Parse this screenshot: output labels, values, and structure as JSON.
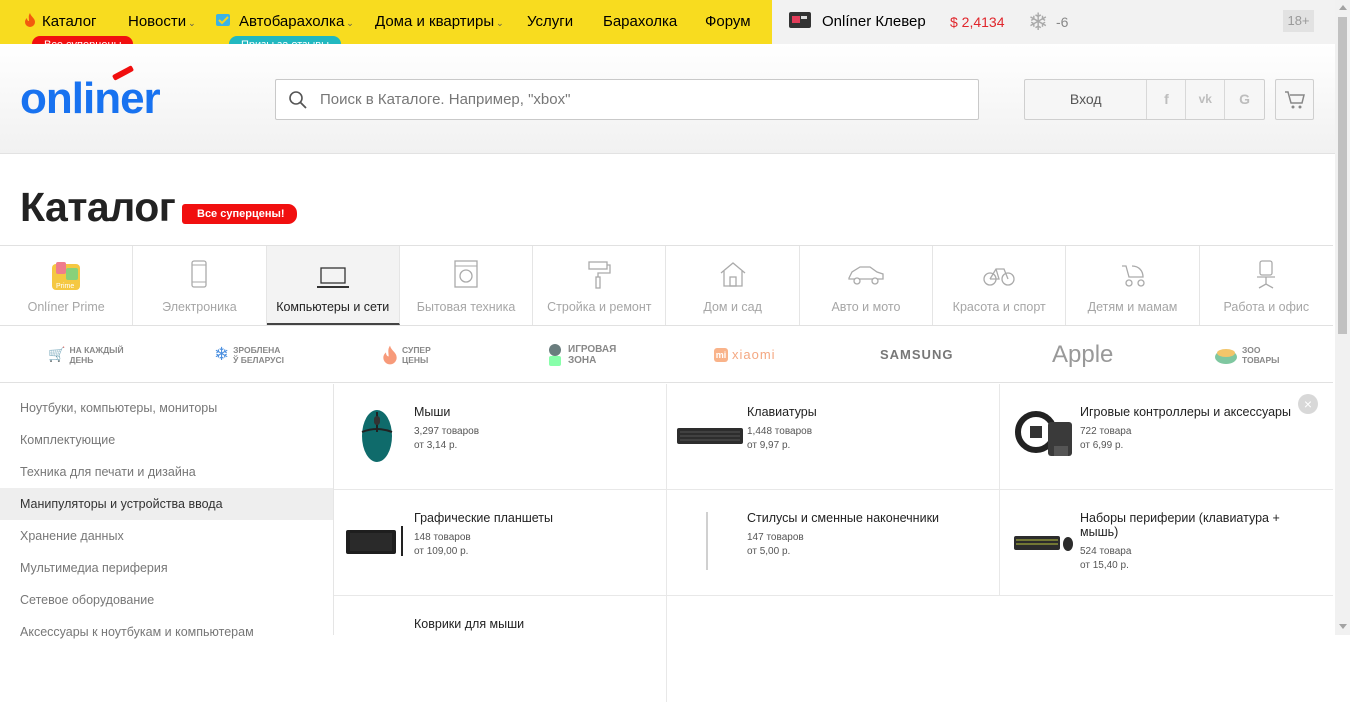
{
  "topnav": {
    "items": [
      {
        "label": "Каталог"
      },
      {
        "label": "Новости"
      },
      {
        "label": "Автобарахолка"
      },
      {
        "label": "Дома и квартиры"
      },
      {
        "label": "Услуги"
      },
      {
        "label": "Барахолка"
      },
      {
        "label": "Форум"
      }
    ],
    "badge_catalog": "Все суперцены",
    "badge_auto": "Призы за отзывы",
    "clever": "Onlíner Клевер",
    "currency": "$ 2,4134",
    "weather": "-6",
    "age": "18+"
  },
  "header": {
    "logo": "onliner",
    "search_placeholder": "Поиск в Каталоге. Например, \"xbox\"",
    "login": "Вход",
    "social": [
      "f",
      "vk",
      "G"
    ]
  },
  "page": {
    "title": "Каталог",
    "badge": "Все суперцены!"
  },
  "categories": [
    {
      "label": "Onlíner Prime",
      "icon": "prime-icon"
    },
    {
      "label": "Электроника",
      "icon": "phone-icon"
    },
    {
      "label": "Компьютеры и сети",
      "icon": "laptop-icon",
      "active": true
    },
    {
      "label": "Бытовая техника",
      "icon": "washer-icon"
    },
    {
      "label": "Стройка и ремонт",
      "icon": "paint-roller-icon"
    },
    {
      "label": "Дом и сад",
      "icon": "house-icon"
    },
    {
      "label": "Авто и мото",
      "icon": "car-icon"
    },
    {
      "label": "Красота и спорт",
      "icon": "bicycle-icon"
    },
    {
      "label": "Детям и мамам",
      "icon": "stroller-icon"
    },
    {
      "label": "Работа и офис",
      "icon": "office-chair-icon"
    }
  ],
  "promos": [
    {
      "text": "На каждый\nдень"
    },
    {
      "text": "Зроблена\nў Беларусі"
    },
    {
      "text": "Супер\nцены"
    },
    {
      "text": "Игровая\nзона"
    },
    {
      "text": "xiaomi"
    },
    {
      "text": "SAMSUNG"
    },
    {
      "text": "Apple"
    },
    {
      "text": "Зоо\nтовары"
    }
  ],
  "sidebar": [
    {
      "label": "Ноутбуки, компьютеры, мониторы"
    },
    {
      "label": "Комплектующие"
    },
    {
      "label": "Техника для печати и дизайна"
    },
    {
      "label": "Манипуляторы и устройства ввода",
      "active": true
    },
    {
      "label": "Хранение данных"
    },
    {
      "label": "Мультимедиа периферия"
    },
    {
      "label": "Сетевое оборудование"
    },
    {
      "label": "Аксессуары к ноутбукам и компьютерам"
    }
  ],
  "products": [
    {
      "name": "Мыши",
      "count": "3,297 товаров",
      "price": "от 3,14 р."
    },
    {
      "name": "Клавиатуры",
      "count": "1,448 товаров",
      "price": "от 9,97 р."
    },
    {
      "name": "Игровые контроллеры и аксессуары",
      "count": "722 товара",
      "price": "от 6,99 р."
    },
    {
      "name": "Графические планшеты",
      "count": "148 товаров",
      "price": "от 109,00 р."
    },
    {
      "name": "Стилусы и сменные наконечники",
      "count": "147 товаров",
      "price": "от 5,00 р."
    },
    {
      "name": "Наборы периферии (клавиатура + мышь)",
      "count": "524 товара",
      "price": "от 15,40 р."
    },
    {
      "name": "Коврики для мыши",
      "count": "",
      "price": ""
    }
  ]
}
